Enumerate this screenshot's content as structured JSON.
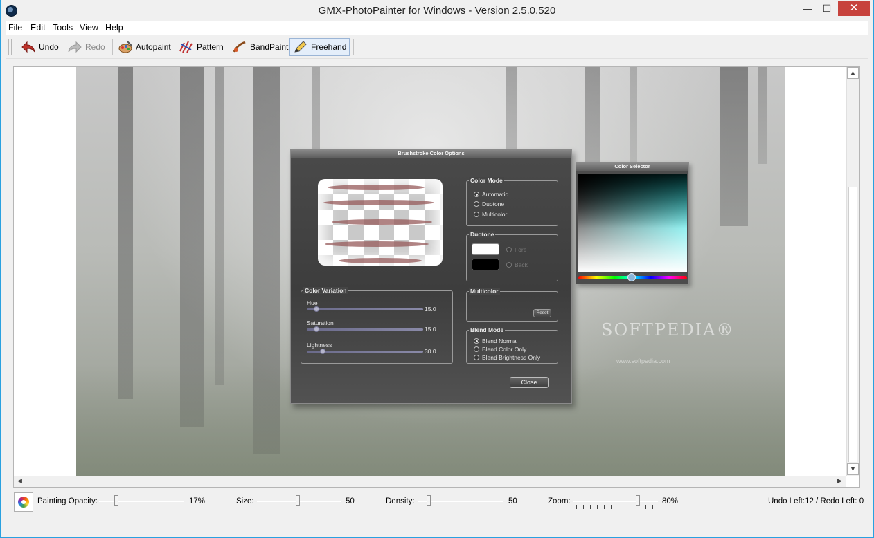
{
  "window": {
    "title": "GMX-PhotoPainter for Windows - Version 2.5.0.520",
    "min_glyph": "—",
    "max_glyph": "☐",
    "close_glyph": "✕"
  },
  "menu": [
    "File",
    "Edit",
    "Tools",
    "View",
    "Help"
  ],
  "toolbar": {
    "undo": "Undo",
    "redo": "Redo",
    "autopaint": "Autopaint",
    "pattern": "Pattern",
    "bandpaint": "BandPaint",
    "freehand": "Freehand"
  },
  "canvas": {
    "watermark": "SOFTPEDIA®",
    "watermark_url": "www.softpedia.com"
  },
  "dialog": {
    "title": "Brushstroke Color Options",
    "color_mode": {
      "label": "Color Mode",
      "options": [
        "Automatic",
        "Duotone",
        "Multicolor"
      ],
      "selected": "Automatic"
    },
    "duotone": {
      "label": "Duotone",
      "fore_label": "Fore",
      "back_label": "Back",
      "fore_color": "#ffffff",
      "back_color": "#000000"
    },
    "multicolor": {
      "label": "Multicolor",
      "reset_label": "Reset"
    },
    "blend_mode": {
      "label": "Blend Mode",
      "options": [
        "Blend Normal",
        "Blend Color Only",
        "Blend Brightness Only"
      ],
      "selected": "Blend Normal"
    },
    "color_variation": {
      "label": "Color Variation",
      "hue_label": "Hue",
      "hue_value": "15.0",
      "saturation_label": "Saturation",
      "saturation_value": "15.0",
      "lightness_label": "Lightness",
      "lightness_value": "30.0"
    },
    "close_label": "Close"
  },
  "color_selector": {
    "title": "Color Selector",
    "hue_color": "#10e0e0"
  },
  "statusbar": {
    "opacity_label": "Painting Opacity:",
    "opacity_value": "17%",
    "size_label": "Size:",
    "size_value": "50",
    "density_label": "Density:",
    "density_value": "50",
    "zoom_label": "Zoom:",
    "zoom_value": "80%",
    "undo_redo": "Undo Left:12 / Redo Left: 0"
  }
}
